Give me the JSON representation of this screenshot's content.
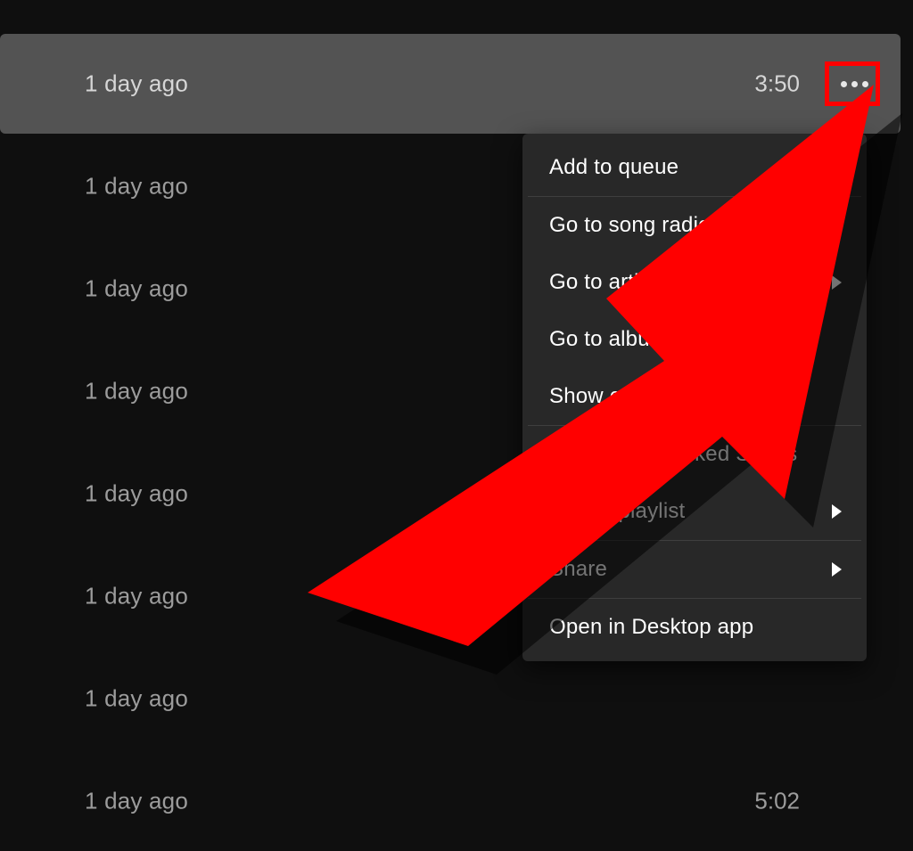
{
  "colors": {
    "bg_dark": "#0f0f0f",
    "row_hover": "#535353",
    "text_muted": "#9c9c9c",
    "text_hovered": "#d6d6d6",
    "menu_bg": "#282828",
    "menu_sep": "#3e3e3e",
    "accent_red": "#ff0000"
  },
  "tracklist": {
    "rows": [
      {
        "date_added": "1 day ago",
        "duration": "3:50",
        "hovered": true,
        "show_more": true
      },
      {
        "date_added": "1 day ago",
        "duration": "",
        "hovered": false,
        "show_more": false
      },
      {
        "date_added": "1 day ago",
        "duration": "",
        "hovered": false,
        "show_more": false
      },
      {
        "date_added": "1 day ago",
        "duration": "",
        "hovered": false,
        "show_more": false
      },
      {
        "date_added": "1 day ago",
        "duration": "",
        "hovered": false,
        "show_more": false
      },
      {
        "date_added": "1 day ago",
        "duration": "",
        "hovered": false,
        "show_more": false
      },
      {
        "date_added": "1 day ago",
        "duration": "",
        "hovered": false,
        "show_more": false
      },
      {
        "date_added": "1 day ago",
        "duration": "5:02",
        "hovered": false,
        "show_more": false
      }
    ]
  },
  "context_menu": {
    "open_for_row_index": 0,
    "items": [
      {
        "label": "Add to queue",
        "has_submenu": false,
        "separator_after": true
      },
      {
        "label": "Go to song radio",
        "has_submenu": false,
        "separator_after": false
      },
      {
        "label": "Go to artist",
        "has_submenu": true,
        "separator_after": false
      },
      {
        "label": "Go to album",
        "has_submenu": false,
        "separator_after": false
      },
      {
        "label": "Show credits",
        "has_submenu": false,
        "separator_after": true
      },
      {
        "label": "Save to your Liked Songs",
        "has_submenu": false,
        "separator_after": false
      },
      {
        "label": "Add to playlist",
        "has_submenu": true,
        "separator_after": true
      },
      {
        "label": "Share",
        "has_submenu": true,
        "separator_after": true
      },
      {
        "label": "Open in Desktop app",
        "has_submenu": false,
        "separator_after": false
      }
    ]
  },
  "annotation": {
    "type": "arrow",
    "color": "#ff0000",
    "points_to": "more-options-button"
  }
}
